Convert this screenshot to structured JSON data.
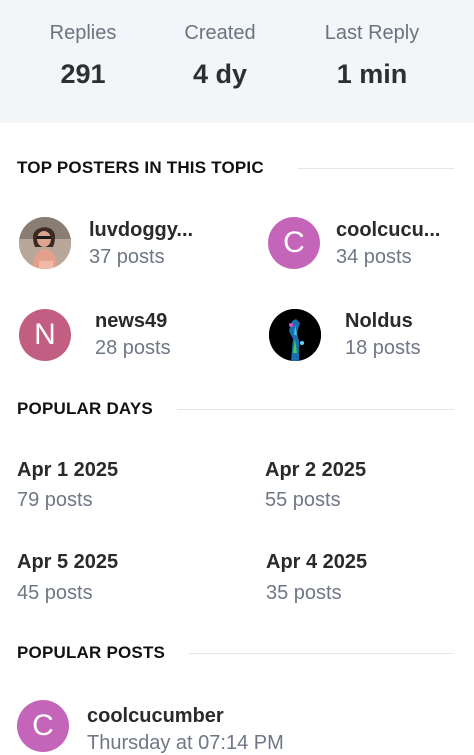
{
  "stats": {
    "replies": {
      "label": "Replies",
      "value": "291"
    },
    "created": {
      "label": "Created",
      "value": "4 dy"
    },
    "last_reply": {
      "label": "Last Reply",
      "value": "1 min"
    }
  },
  "top_posters": {
    "heading": "TOP POSTERS IN THIS TOPIC",
    "users": [
      {
        "name": "luvdoggy...",
        "posts": "37 posts",
        "avatar": "photo"
      },
      {
        "name": "coolcucu...",
        "posts": "34 posts",
        "avatar_letter": "C",
        "avatar_color": "#c565b9"
      },
      {
        "name": "news49",
        "posts": "28 posts",
        "avatar_letter": "N",
        "avatar_color": "#c25e82"
      },
      {
        "name": "Noldus",
        "posts": "18 posts",
        "avatar": "photo"
      }
    ]
  },
  "popular_days": {
    "heading": "POPULAR DAYS",
    "days": [
      {
        "date": "Apr 1 2025",
        "posts": "79 posts"
      },
      {
        "date": "Apr 2 2025",
        "posts": "55 posts"
      },
      {
        "date": "Apr 5 2025",
        "posts": "45 posts"
      },
      {
        "date": "Apr 4 2025",
        "posts": "35 posts"
      }
    ]
  },
  "popular_posts": {
    "heading": "POPULAR POSTS",
    "posts": [
      {
        "author": "coolcucumber",
        "time": "Thursday at 07:14 PM",
        "avatar_letter": "C",
        "avatar_color": "#c565b9"
      }
    ]
  }
}
